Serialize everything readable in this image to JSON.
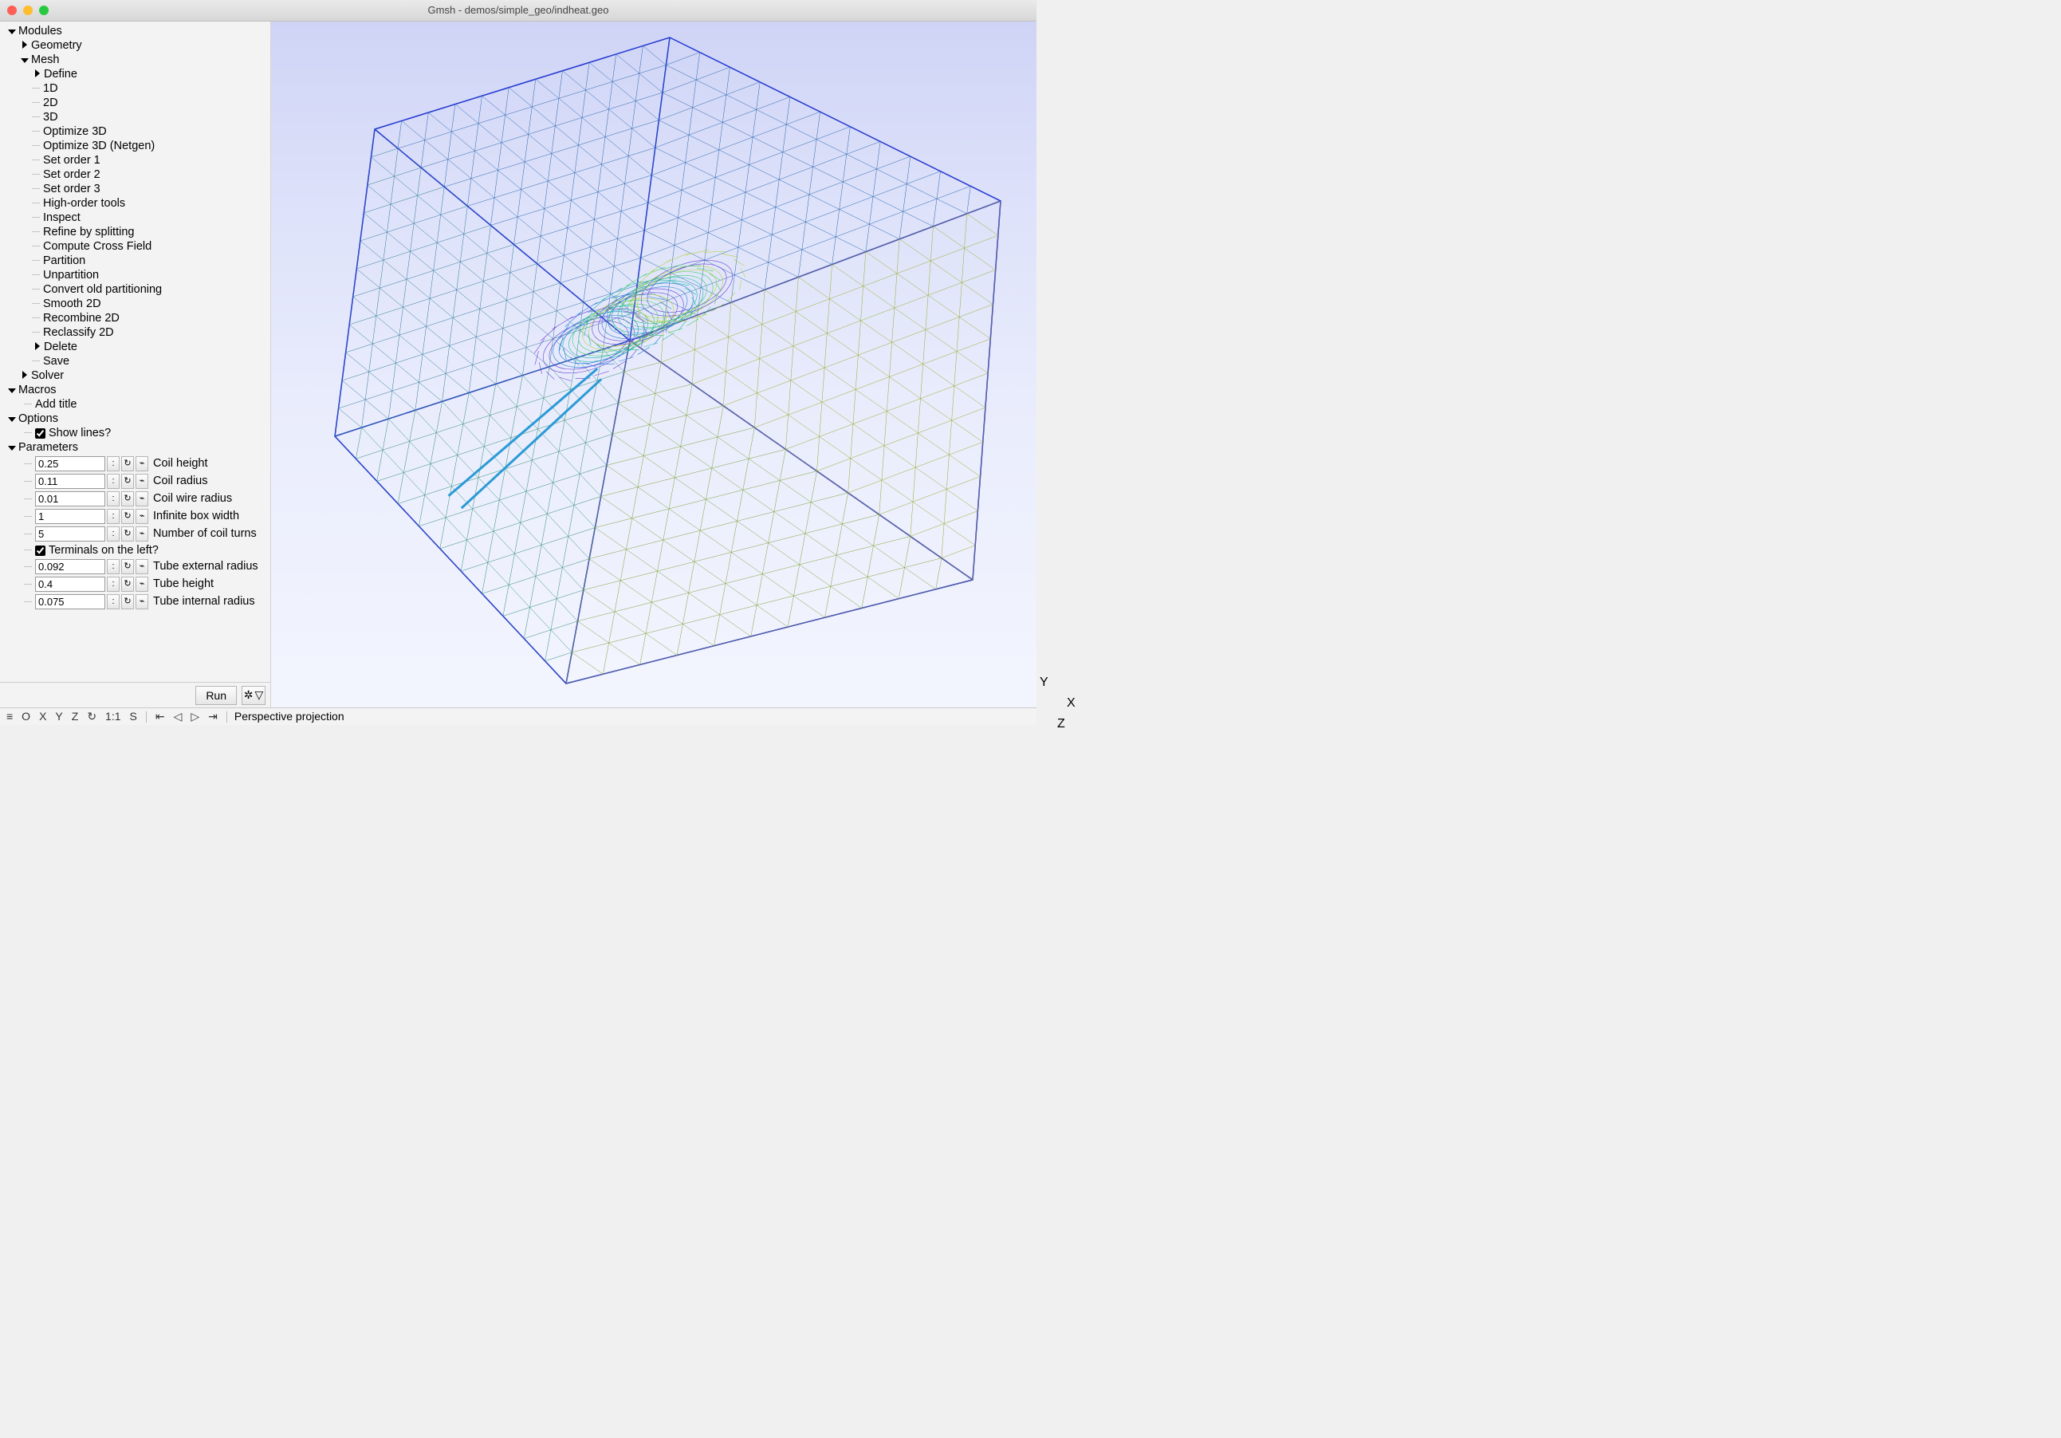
{
  "title": "Gmsh - demos/simple_geo/indheat.geo",
  "tree": {
    "modules": "Modules",
    "geometry": "Geometry",
    "mesh": "Mesh",
    "mesh_items": [
      "Define",
      "1D",
      "2D",
      "3D",
      "Optimize 3D",
      "Optimize 3D (Netgen)",
      "Set order 1",
      "Set order 2",
      "Set order 3",
      "High-order tools",
      "Inspect",
      "Refine by splitting",
      "Compute Cross Field",
      "Partition",
      "Unpartition",
      "Convert old partitioning",
      "Smooth 2D",
      "Recombine 2D",
      "Reclassify 2D",
      "Delete",
      "Save"
    ],
    "solver": "Solver",
    "macros": "Macros",
    "add_title": "Add title",
    "options": "Options",
    "show_lines": "Show lines?",
    "parameters": "Parameters",
    "terminals": "Terminals on the left?"
  },
  "params": [
    {
      "value": "0.25",
      "label": "Coil height"
    },
    {
      "value": "0.11",
      "label": "Coil radius"
    },
    {
      "value": "0.01",
      "label": "Coil wire radius"
    },
    {
      "value": "1",
      "label": "Infinite box width"
    },
    {
      "value": "5",
      "label": "Number of coil turns"
    }
  ],
  "params2": [
    {
      "value": "0.092",
      "label": "Tube external radius"
    },
    {
      "value": "0.4",
      "label": "Tube height"
    },
    {
      "value": "0.075",
      "label": "Tube internal radius"
    }
  ],
  "glyphs": {
    "dots": ":",
    "reset": "↻",
    "graph": "⌁"
  },
  "run": "Run",
  "status": {
    "menu": "≡",
    "O": "O",
    "X": "X",
    "Y": "Y",
    "Z": "Z",
    "rot": "↻",
    "ratio": "1:1",
    "S": "S",
    "first": "⇤",
    "prev": "◁",
    "play": "▷",
    "last": "⇥",
    "proj": "Perspective projection"
  },
  "axes": {
    "Y": "Y",
    "X": "X",
    "Z": "Z"
  }
}
